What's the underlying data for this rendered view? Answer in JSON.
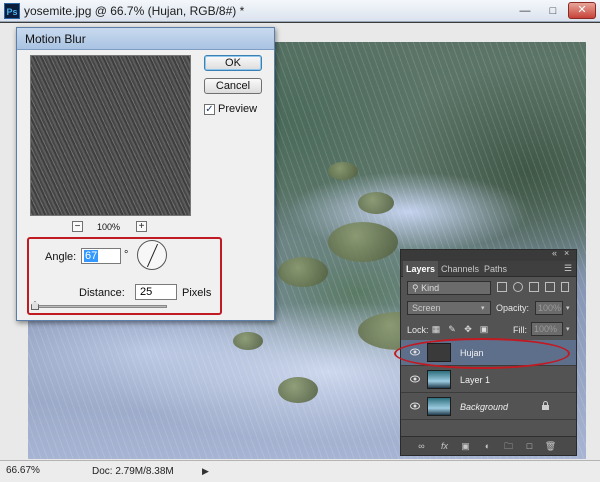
{
  "window": {
    "title": "yosemite.jpg @ 66.7% (Hujan, RGB/8#) *",
    "app_icon": "Ps"
  },
  "status": {
    "zoom": "66.67%",
    "doc_size": "Doc: 2.79M/8.38M"
  },
  "motion_blur": {
    "title": "Motion Blur",
    "ok": "OK",
    "cancel": "Cancel",
    "preview_label": "Preview",
    "preview_checked": "✓",
    "zoom_level": "100%",
    "zoom_out": "−",
    "zoom_in": "+",
    "angle_label": "Angle:",
    "angle_value": "67",
    "degree": "°",
    "distance_label": "Distance:",
    "distance_value": "25",
    "distance_unit": "Pixels"
  },
  "layers_panel": {
    "tabs": [
      "Layers",
      "Channels",
      "Paths"
    ],
    "filter_label": "Kind",
    "blend_mode": "Screen",
    "opacity_label": "Opacity:",
    "opacity_value": "100%",
    "lock_label": "Lock:",
    "fill_label": "Fill:",
    "fill_value": "100%",
    "layers": [
      {
        "name": "Hujan",
        "selected": true
      },
      {
        "name": "Layer 1",
        "selected": false
      },
      {
        "name": "Background",
        "selected": false
      }
    ]
  },
  "colors": {
    "highlight_red": "#c01b22",
    "selected_layer": "#5e6f8c"
  }
}
